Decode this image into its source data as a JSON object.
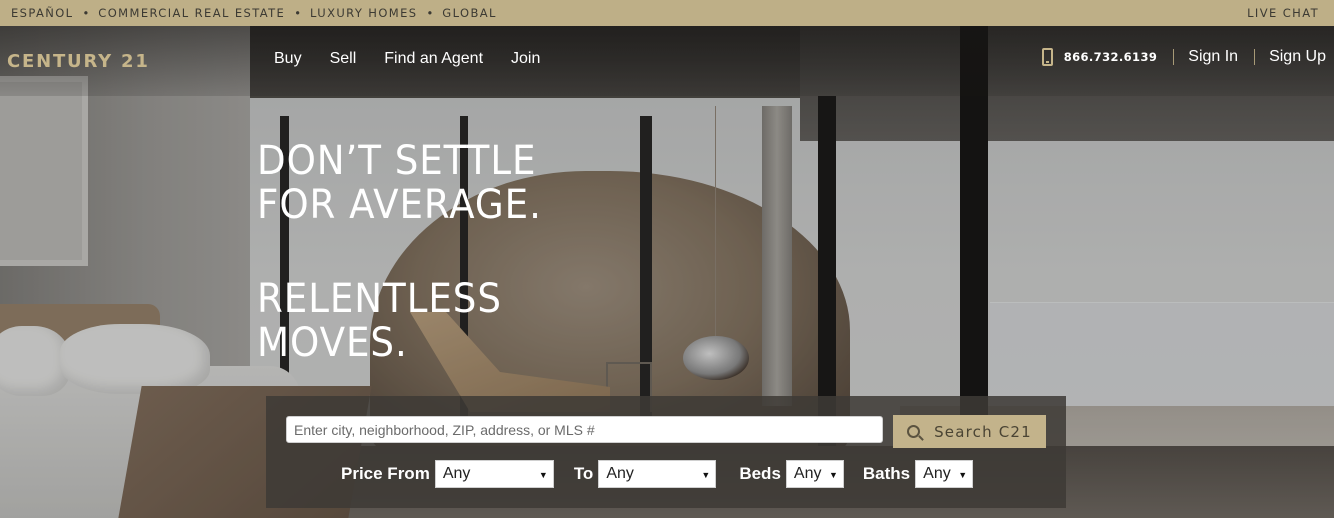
{
  "topbar": {
    "links": [
      "ESPAÑOL",
      "COMMERCIAL REAL ESTATE",
      "LUXURY HOMES",
      "GLOBAL"
    ],
    "separator": "•",
    "live_chat": "LIVE CHAT"
  },
  "nav": {
    "logo": "CENTURY 21",
    "menu": [
      "Buy",
      "Sell",
      "Find an Agent",
      "Join"
    ],
    "phone_icon": "phone-icon",
    "phone": "866.732.6139",
    "sign_in": "Sign In",
    "sign_up": "Sign Up"
  },
  "hero": {
    "headline_lines_1": [
      "DON’T SETTLE",
      "FOR AVERAGE."
    ],
    "headline_lines_2": [
      "RELENTLESS",
      "MOVES."
    ]
  },
  "search": {
    "placeholder": "Enter city, neighborhood, ZIP, address, or MLS #",
    "value": "",
    "button_icon": "search-icon",
    "button_label": "Search C21",
    "filters": {
      "price_from_label": "Price From",
      "price_from_value": "Any",
      "to_label": "To",
      "to_value": "Any",
      "beds_label": "Beds",
      "beds_value": "Any",
      "baths_label": "Baths",
      "baths_value": "Any"
    }
  },
  "colors": {
    "brand_gold": "#beaf87",
    "logo_gold": "#c6b58a",
    "panel_bg": "#3e3a36"
  }
}
